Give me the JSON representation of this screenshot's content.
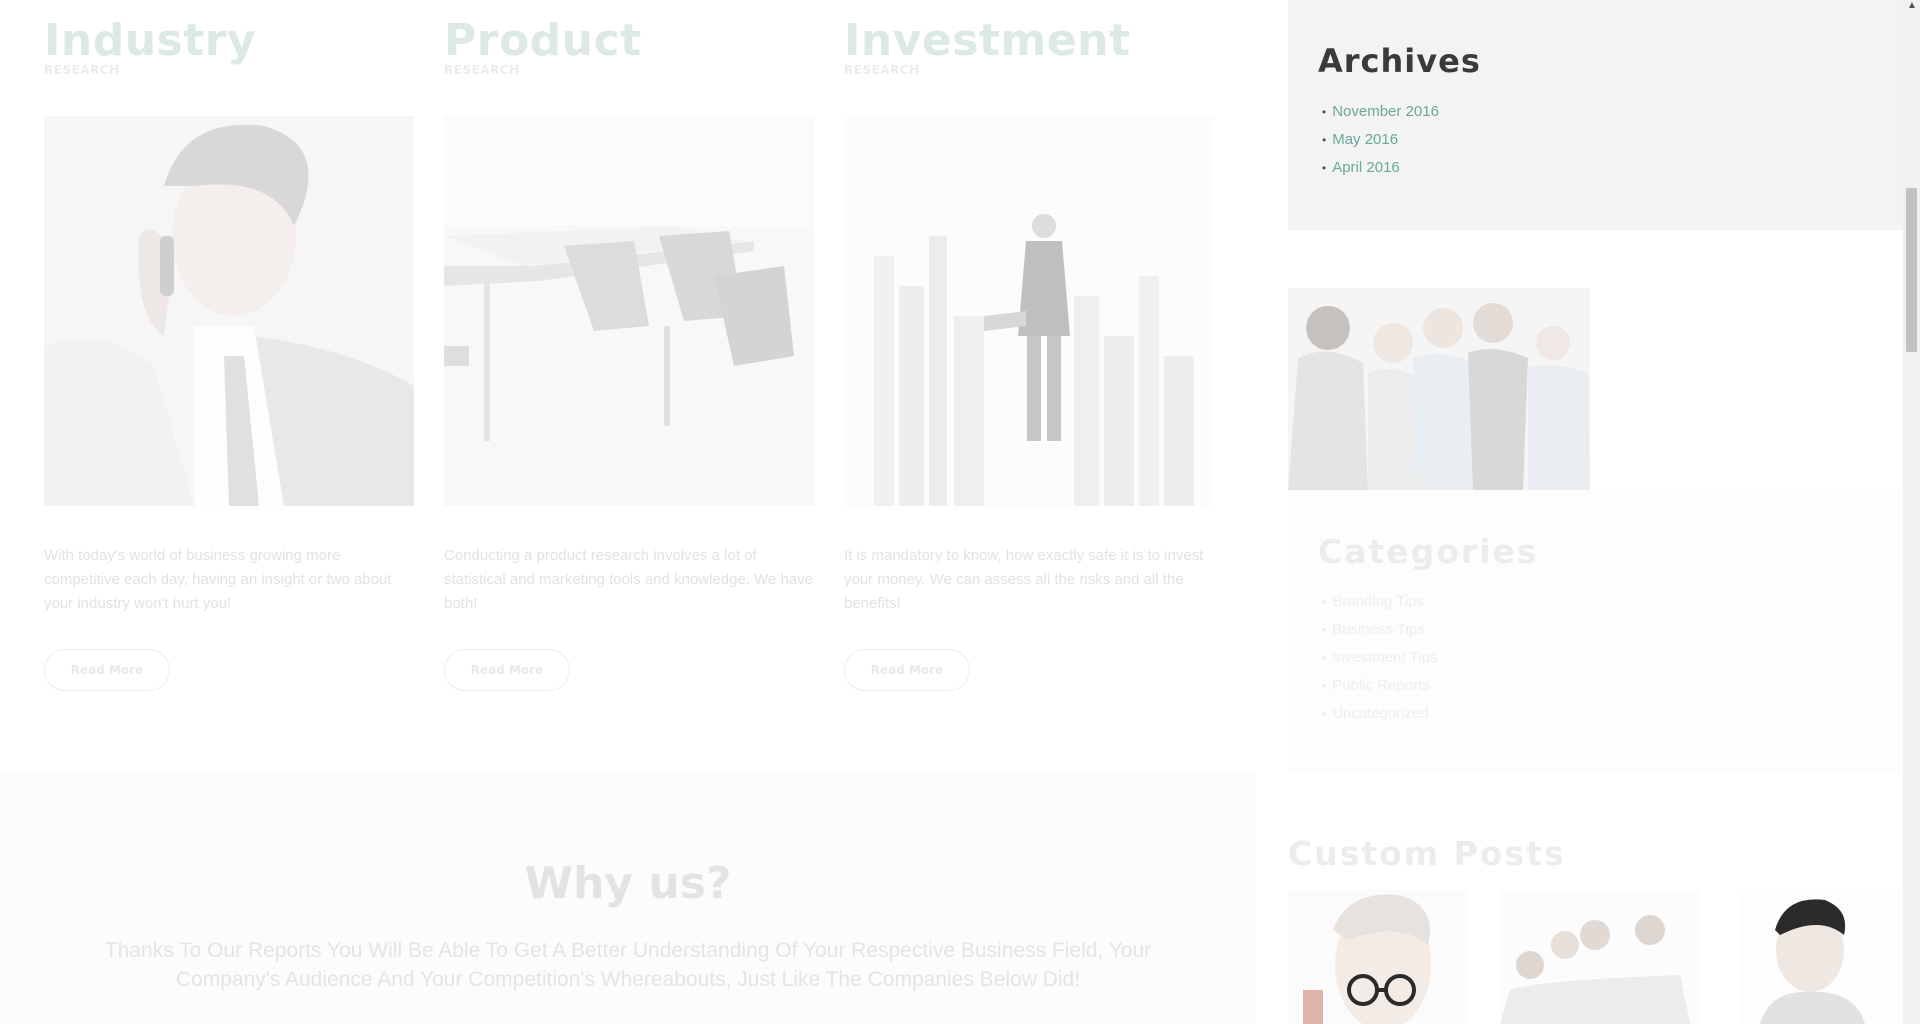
{
  "cards": [
    {
      "title": "Industry",
      "subtitle": "RESEARCH",
      "description": "With today's world of business growing more competitive each day, having an insight or two about your industry won't hurt you!",
      "button": "Read More"
    },
    {
      "title": "Product",
      "subtitle": "RESEARCH",
      "description": "Conducting a product research involves a lot of statistical and marketing tools and knowledge. We have both!",
      "button": "Read More"
    },
    {
      "title": "Investment",
      "subtitle": "RESEARCH",
      "description": "It is mandatory to know, how exactly safe it is to invest your money. We can assess all the risks and all the benefits!",
      "button": "Read More"
    }
  ],
  "sidebar": {
    "archives": {
      "title": "Archives",
      "items": [
        "November 2016",
        "May 2016",
        "April 2016"
      ]
    },
    "categories": {
      "title": "Categories",
      "items": [
        "Branding Tips",
        "Business Tips",
        "Investment Tips",
        "Public Reports",
        "Uncategorized"
      ]
    },
    "custom_posts": {
      "title": "Custom Posts"
    }
  },
  "why_us": {
    "title": "Why us?",
    "text": "Thanks To Our Reports You Will Be Able To Get A Better Understanding Of  Your Respective Business Field, Your Company's Audience And Your Competition's Whereabouts, Just Like The Companies Below Did!"
  },
  "colors": {
    "accent": "#6aa89a",
    "archives_bg": "#f3f3f3",
    "faded_text": "#e2e2e2"
  },
  "icons": {
    "scroll_up": "arrow-up-icon"
  }
}
